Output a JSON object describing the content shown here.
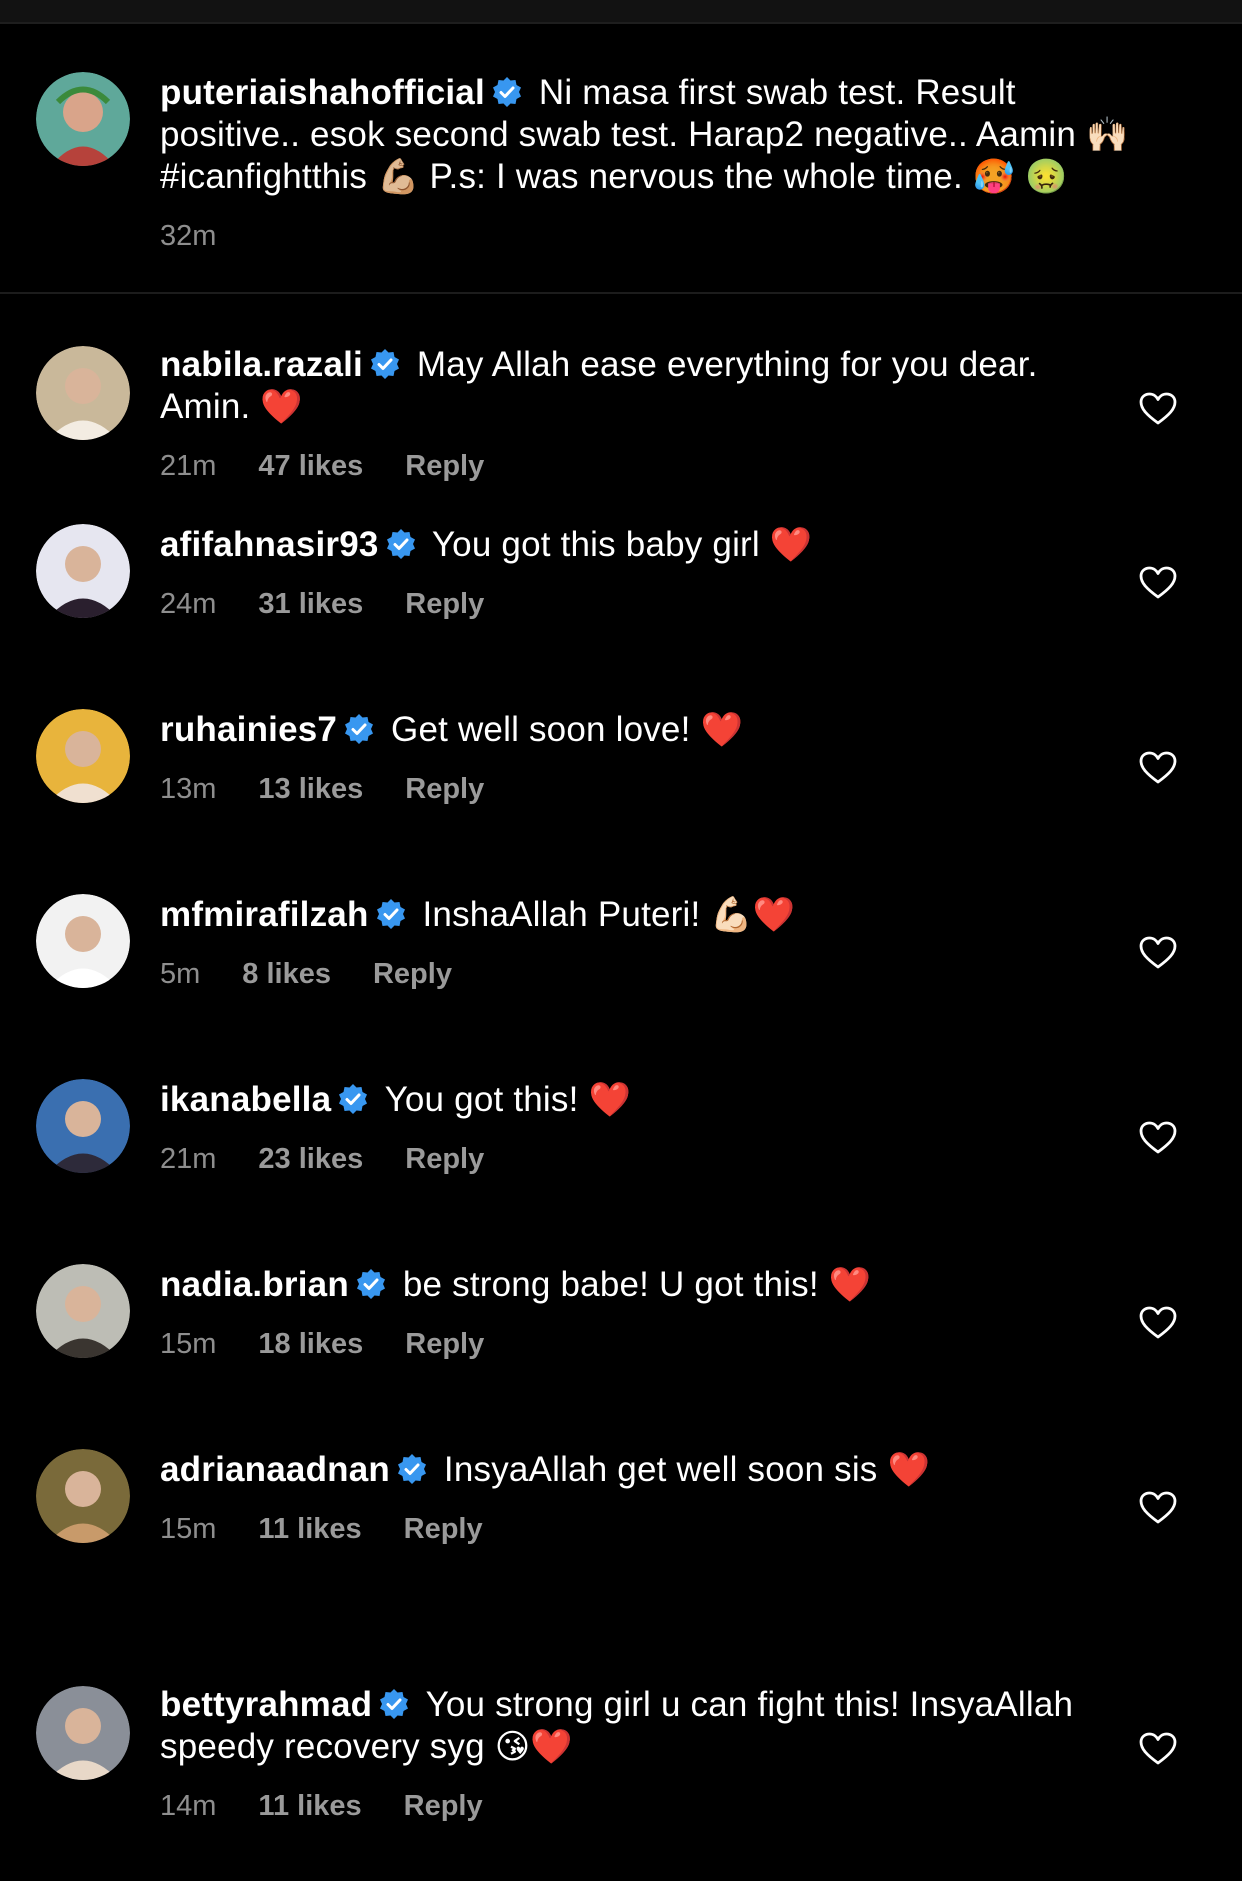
{
  "caption": {
    "username": "puteriaishahofficial",
    "text_part1": "Ni masa first swab test. Result positive.. esok second swab test. Harap2 negative.. Aamin",
    "emoji_hands": "🙌🏻",
    "hashtag": "#icanfightthis",
    "emoji_muscle": "💪🏼",
    "text_part2": "P.s: I was nervous the whole time.",
    "emoji_hot": "🥵",
    "emoji_sick": "🤢",
    "time": "32m"
  },
  "comments": [
    {
      "username": "nabila.razali",
      "text": "May Allah ease everything for you dear. Amin.",
      "emoji": "❤️",
      "time": "21m",
      "likes": "47 likes",
      "reply": "Reply"
    },
    {
      "username": "afifahnasir93",
      "text": "You got this baby girl",
      "emoji": "❤️",
      "time": "24m",
      "likes": "31 likes",
      "reply": "Reply"
    },
    {
      "username": "ruhainies7",
      "text": "Get well soon love!",
      "emoji": "❤️",
      "time": "13m",
      "likes": "13 likes",
      "reply": "Reply"
    },
    {
      "username": "mfmirafilzah",
      "text": "InshaAllah Puteri!",
      "emoji": "💪🏻❤️",
      "time": "5m",
      "likes": "8 likes",
      "reply": "Reply"
    },
    {
      "username": "ikanabella",
      "text": "You got this!",
      "emoji": "❤️",
      "time": "21m",
      "likes": "23 likes",
      "reply": "Reply"
    },
    {
      "username": "nadia.brian",
      "text": "be strong babe! U got this!",
      "emoji": "❤️",
      "time": "15m",
      "likes": "18 likes",
      "reply": "Reply"
    },
    {
      "username": "adrianaadnan",
      "text": "InsyaAllah get well soon sis",
      "emoji": "❤️",
      "time": "15m",
      "likes": "11 likes",
      "reply": "Reply"
    },
    {
      "username": "bettyrahmad",
      "text": "You strong girl u can fight this! InsyaAllah speedy recovery syg",
      "emoji": "😘❤️",
      "time": "14m",
      "likes": "11 likes",
      "reply": "Reply"
    }
  ],
  "colors": {
    "background": "#000000",
    "verified": "#3897f0",
    "meta": "#8e8e8e",
    "heart_outline": "#ffffff"
  },
  "icons": {
    "verified": "verified-badge-icon",
    "like": "heart-outline-icon"
  }
}
